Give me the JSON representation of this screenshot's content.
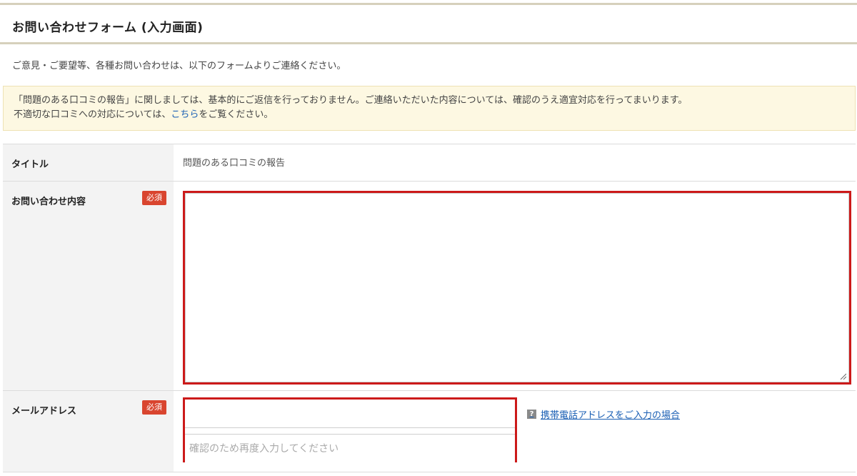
{
  "page": {
    "title": "お問い合わせフォーム (入力画面)",
    "intro": "ご意見・ご要望等、各種お問い合わせは、以下のフォームよりご連絡ください。"
  },
  "notice": {
    "line1": "「問題のある口コミの報告」に関しましては、基本的にご返信を行っておりません。ご連絡いただいた内容については、確認のうえ適宜対応を行ってまいります。",
    "line2_prefix": "不適切な口コミへの対応については、",
    "link": "こちら",
    "line2_suffix": "をご覧ください。"
  },
  "form": {
    "title_row": {
      "label": "タイトル",
      "value": "問題のある口コミの報告"
    },
    "content_row": {
      "label": "お問い合わせ内容",
      "badge": "必須",
      "value": ""
    },
    "email_row": {
      "label": "メールアドレス",
      "badge": "必須",
      "value": "",
      "confirm_placeholder": "確認のため再度入力してください",
      "help_icon": "question-icon",
      "help_text": "携帯電話アドレスをご入力の場合"
    }
  },
  "colors": {
    "header_border": "#d6d0bc",
    "notice_bg": "#fdf8e2",
    "badge": "#d9452f",
    "error_border": "#cc1a1a",
    "link": "#1a5fb4",
    "label_bg": "#f3f3f3"
  }
}
